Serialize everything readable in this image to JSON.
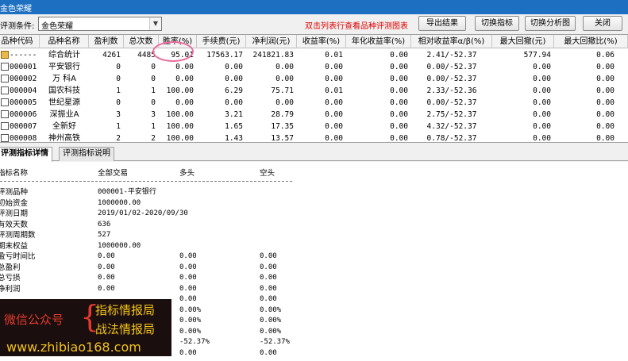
{
  "window": {
    "title": "金色荣耀"
  },
  "toolbar": {
    "label": "评测条件:",
    "selected_condition": "金色荣耀",
    "hint": "双击列表行查看品种评测图表",
    "buttons": {
      "export": "导出结果",
      "switch_indicator": "切换指标",
      "switch_chart": "切换分析图",
      "close": "关闭"
    }
  },
  "grid": {
    "headers": [
      "品种代码",
      "品种名称",
      "盈利数",
      "总次数",
      "胜率(%)",
      "手续费(元)",
      "净利润(元)",
      "收益率(%)",
      "年化收益率(%)",
      "相对收益率α/β(%)",
      "最大回撤(元)",
      "最大回撤比(%)"
    ],
    "rows": [
      {
        "code": "------",
        "name": "综合统计",
        "win": "4261",
        "total": "4485",
        "rate": "95.01",
        "fee": "17563.17",
        "profit": "241821.83",
        "ret": "0.01",
        "annual": "0.00",
        "rel": "2.41/-52.37",
        "dd": "577.94",
        "ddr": "0.06"
      },
      {
        "code": "000001",
        "name": "平安银行",
        "win": "0",
        "total": "0",
        "rate": "0.00",
        "fee": "0.00",
        "profit": "0.00",
        "ret": "0.00",
        "annual": "0.00",
        "rel": "0.00/-52.37",
        "dd": "0.00",
        "ddr": "0.00"
      },
      {
        "code": "000002",
        "name": "万 科A",
        "win": "0",
        "total": "0",
        "rate": "0.00",
        "fee": "0.00",
        "profit": "0.00",
        "ret": "0.00",
        "annual": "0.00",
        "rel": "0.00/-52.37",
        "dd": "0.00",
        "ddr": "0.00"
      },
      {
        "code": "000004",
        "name": "国农科技",
        "win": "1",
        "total": "1",
        "rate": "100.00",
        "fee": "6.29",
        "profit": "75.71",
        "ret": "0.01",
        "annual": "0.00",
        "rel": "2.33/-52.36",
        "dd": "0.00",
        "ddr": "0.00"
      },
      {
        "code": "000005",
        "name": "世纪星源",
        "win": "0",
        "total": "0",
        "rate": "0.00",
        "fee": "0.00",
        "profit": "0.00",
        "ret": "0.00",
        "annual": "0.00",
        "rel": "0.00/-52.37",
        "dd": "0.00",
        "ddr": "0.00"
      },
      {
        "code": "000006",
        "name": "深振业A",
        "win": "3",
        "total": "3",
        "rate": "100.00",
        "fee": "3.21",
        "profit": "28.79",
        "ret": "0.00",
        "annual": "0.00",
        "rel": "2.75/-52.37",
        "dd": "0.00",
        "ddr": "0.00"
      },
      {
        "code": "000007",
        "name": "全新好",
        "win": "1",
        "total": "1",
        "rate": "100.00",
        "fee": "1.65",
        "profit": "17.35",
        "ret": "0.00",
        "annual": "0.00",
        "rel": "4.32/-52.37",
        "dd": "0.00",
        "ddr": "0.00"
      },
      {
        "code": "000008",
        "name": "神州高铁",
        "win": "2",
        "total": "2",
        "rate": "100.00",
        "fee": "1.43",
        "profit": "13.57",
        "ret": "0.00",
        "annual": "0.00",
        "rel": "0.78/-52.37",
        "dd": "0.00",
        "ddr": "0.00"
      }
    ]
  },
  "tabs": [
    "评测指标详情",
    "评测指标说明"
  ],
  "detail": {
    "headers": [
      "指标名称",
      "全部交易",
      "多头",
      "空头"
    ],
    "rows": [
      {
        "label": "评测品种",
        "all": "000001-平安银行",
        "long": "",
        "short": ""
      },
      {
        "label": "初始资金",
        "all": "1000000.00",
        "long": "",
        "short": ""
      },
      {
        "label": "评测日期",
        "all": "2019/01/02-2020/09/30",
        "long": "",
        "short": ""
      },
      {
        "label": "有效天数",
        "all": "636",
        "long": "",
        "short": ""
      },
      {
        "label": "评测周期数",
        "all": "527",
        "long": "",
        "short": ""
      },
      {
        "label": "期末权益",
        "all": "1000000.00",
        "long": "",
        "short": ""
      },
      {
        "label": "盈亏时间比",
        "all": "0.00",
        "long": "0.00",
        "short": "0.00"
      },
      {
        "label": "总盈利",
        "all": "0.00",
        "long": "0.00",
        "short": "0.00"
      },
      {
        "label": "总亏损",
        "all": "0.00",
        "long": "0.00",
        "short": "0.00"
      },
      {
        "label": "净利润",
        "all": "0.00",
        "long": "0.00",
        "short": "0.00"
      },
      {
        "label": "",
        "all": "",
        "long": "0.00",
        "short": "0.00"
      },
      {
        "label": "",
        "all": "",
        "long": "0.00%",
        "short": "0.00%"
      },
      {
        "label": "",
        "all": "",
        "long": "0.00%",
        "short": "0.00%"
      },
      {
        "label": "",
        "all": "",
        "long": "0.00%",
        "short": "0.00%"
      },
      {
        "label": "",
        "all": "-52.37%",
        "long": "",
        "short": "-52.37%"
      },
      {
        "label": "",
        "all": "",
        "long": "0.00",
        "short": "0.00"
      }
    ]
  },
  "watermark": {
    "left": "微信公众号",
    "right_top": "指标情报局",
    "right_bottom": "战法情报局",
    "url": "www.zhibiao168.com"
  },
  "colors": {
    "titlebar": "#1d6fc2",
    "hint": "#e00000",
    "highlight_ring": "#ea6d9d",
    "watermark_red": "#e63a2e",
    "watermark_gold": "#f2c318"
  }
}
